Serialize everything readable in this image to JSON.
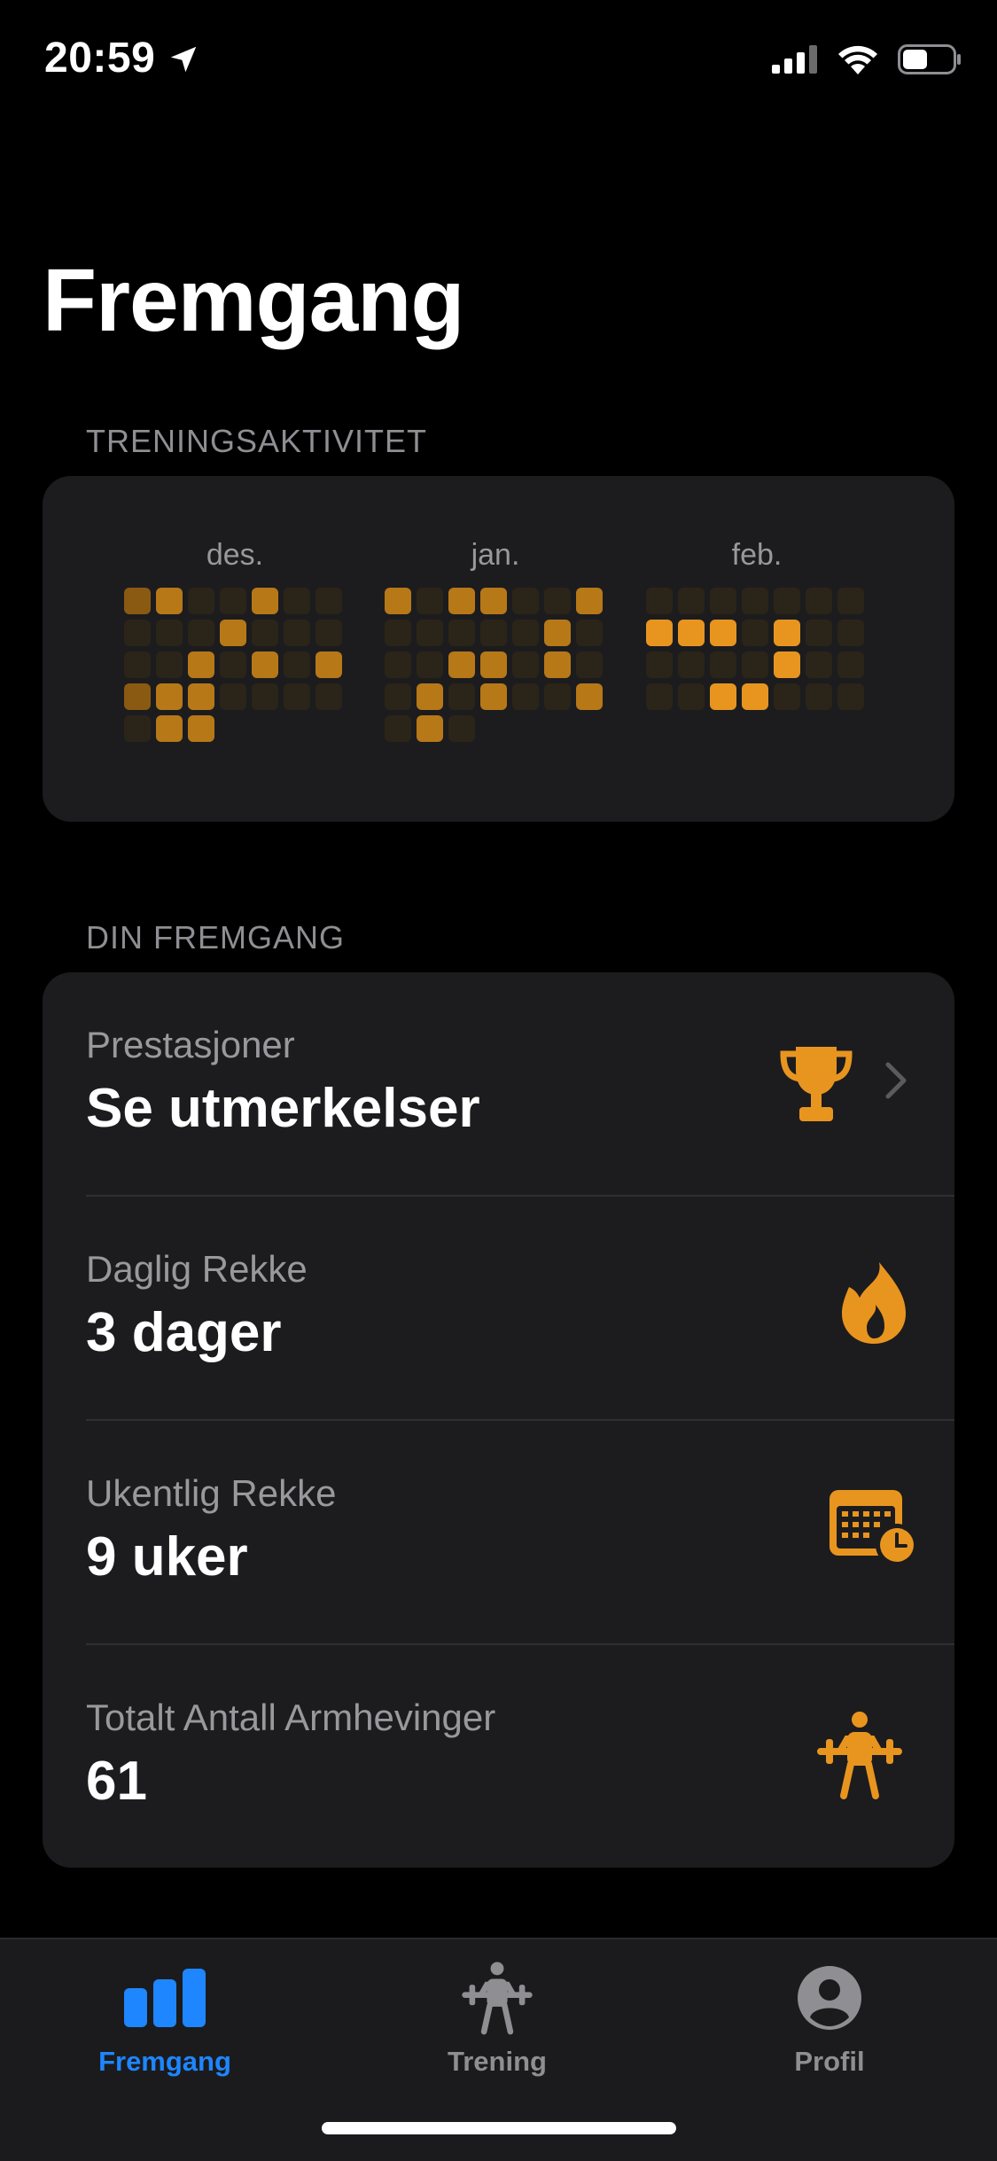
{
  "status_bar": {
    "time": "20:59",
    "battery_level": 0.5
  },
  "header": {
    "title": "Fremgang"
  },
  "activity": {
    "section_label": "TRENINGSAKTIVITET",
    "accent_color": "#e8951f",
    "months": [
      {
        "name": "des.",
        "weeks": [
          [
            1,
            2,
            0,
            0,
            2,
            0,
            0
          ],
          [
            0,
            0,
            0,
            2,
            0,
            0,
            0
          ],
          [
            0,
            0,
            2,
            0,
            2,
            0,
            2
          ],
          [
            1,
            2,
            2,
            0,
            0,
            0,
            0
          ],
          [
            0,
            2,
            2
          ]
        ]
      },
      {
        "name": "jan.",
        "weeks": [
          [
            2,
            0,
            2,
            2,
            0,
            0,
            2
          ],
          [
            0,
            0,
            0,
            0,
            0,
            2,
            0
          ],
          [
            0,
            0,
            2,
            2,
            0,
            2,
            0
          ],
          [
            0,
            2,
            0,
            2,
            0,
            0,
            2
          ],
          [
            0,
            2,
            0
          ]
        ]
      },
      {
        "name": "feb.",
        "weeks": [
          [
            0,
            0,
            0,
            0,
            0,
            0,
            0
          ],
          [
            3,
            3,
            3,
            0,
            3,
            0,
            0
          ],
          [
            0,
            0,
            0,
            0,
            3,
            0,
            0
          ],
          [
            0,
            0,
            3,
            3,
            0,
            0,
            0
          ]
        ]
      }
    ]
  },
  "progress": {
    "section_label": "DIN FREMGANG",
    "items": [
      {
        "label": "Prestasjoner",
        "value": "Se utmerkelser",
        "icon": "trophy-icon"
      },
      {
        "label": "Daglig Rekke",
        "value": "3 dager",
        "icon": "flame-icon"
      },
      {
        "label": "Ukentlig Rekke",
        "value": "9 uker",
        "icon": "calendar-clock-icon"
      },
      {
        "label": "Totalt Antall Armhevinger",
        "value": "61",
        "icon": "weightlifter-icon"
      }
    ]
  },
  "tabbar": {
    "tabs": [
      {
        "label": "Fremgang",
        "icon": "bar-chart-icon",
        "active": true
      },
      {
        "label": "Trening",
        "icon": "weightlifter-icon",
        "active": false
      },
      {
        "label": "Profil",
        "icon": "person-circle-icon",
        "active": false
      }
    ],
    "active_color": "#1e86ff",
    "inactive_color": "#8e8e93"
  }
}
